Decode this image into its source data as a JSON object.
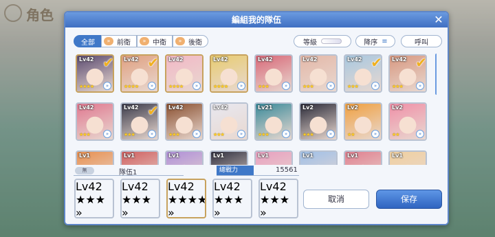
{
  "background": {
    "title": "角色"
  },
  "dialog": {
    "title": "編組我的隊伍",
    "close_label": "✕"
  },
  "filters": {
    "tabs": [
      {
        "label": "全部",
        "active": true
      },
      {
        "label": "前衛",
        "active": false
      },
      {
        "label": "中衛",
        "active": false
      },
      {
        "label": "後衛",
        "active": false
      }
    ],
    "level_label": "等級",
    "sort_label": "降序",
    "call_label": "呼叫"
  },
  "roster": {
    "rows": [
      [
        {
          "level": "Lv42",
          "stars": "★★★★",
          "checked": true,
          "color": "#5a4a70"
        },
        {
          "level": "Lv42",
          "stars": "★★★★",
          "checked": true,
          "color": "#e0a080"
        },
        {
          "level": "Lv42",
          "stars": "★★★★",
          "checked": false,
          "color": "#f2b8c6"
        },
        {
          "level": "Lv42",
          "stars": "★★★★",
          "checked": false,
          "color": "#e8cc70"
        },
        {
          "level": "Lv42",
          "stars": "★★★",
          "checked": false,
          "color": "#d86878"
        },
        {
          "level": "Lv42",
          "stars": "★★★",
          "checked": false,
          "color": "#e4b8a8"
        },
        {
          "level": "Lv42",
          "stars": "★★★",
          "checked": true,
          "color": "#a8c8e0"
        },
        {
          "level": "Lv42",
          "stars": "★★★",
          "checked": true,
          "color": "#d89880"
        }
      ],
      [
        {
          "level": "Lv42",
          "stars": "★★★",
          "checked": false,
          "color": "#e07890"
        },
        {
          "level": "Lv42",
          "stars": "★★★",
          "checked": true,
          "color": "#3a3a4a"
        },
        {
          "level": "Lv42",
          "stars": "★★★",
          "checked": false,
          "color": "#8a5030"
        },
        {
          "level": "Lv42",
          "stars": "★★★",
          "checked": false,
          "color": "#e8e8f0"
        },
        {
          "level": "Lv21",
          "stars": "★★★",
          "checked": false,
          "color": "#3a8a9a"
        },
        {
          "level": "Lv2",
          "stars": "★★★",
          "checked": false,
          "color": "#2a2a38"
        },
        {
          "level": "Lv2",
          "stars": "★★",
          "checked": false,
          "color": "#f0a040"
        },
        {
          "level": "Lv2",
          "stars": "★★",
          "checked": false,
          "color": "#f090a8"
        }
      ],
      [
        {
          "level": "Lv1",
          "stars": "",
          "checked": false,
          "color": "#e89050"
        },
        {
          "level": "Lv1",
          "stars": "",
          "checked": false,
          "color": "#d06060"
        },
        {
          "level": "Lv1",
          "stars": "",
          "checked": false,
          "color": "#b090d8"
        },
        {
          "level": "Lv1",
          "stars": "",
          "checked": false,
          "color": "#303040"
        },
        {
          "level": "Lv1",
          "stars": "",
          "checked": false,
          "color": "#e8a0c0"
        },
        {
          "level": "Lv1",
          "stars": "",
          "checked": false,
          "color": "#a0c0e8"
        },
        {
          "level": "Lv1",
          "stars": "",
          "checked": false,
          "color": "#e08090"
        },
        {
          "level": "Lv1",
          "stars": "",
          "checked": false,
          "color": "#f0d0a0"
        }
      ]
    ]
  },
  "party": {
    "badge": "無",
    "name": "隊伍1",
    "power_label": "總戰力",
    "power_value": "15561",
    "members": [
      {
        "level": "Lv42",
        "stars": "★★★",
        "color": "#3a3a4a"
      },
      {
        "level": "Lv42",
        "stars": "★★★",
        "color": "#f0b090"
      },
      {
        "level": "Lv42",
        "stars": "★★★★",
        "color": "#5a4a70"
      },
      {
        "level": "Lv42",
        "stars": "★★★",
        "color": "#d88060"
      },
      {
        "level": "Lv42",
        "stars": "★★★",
        "color": "#b8d8ec"
      }
    ]
  },
  "buttons": {
    "cancel": "取消",
    "save": "保存"
  }
}
